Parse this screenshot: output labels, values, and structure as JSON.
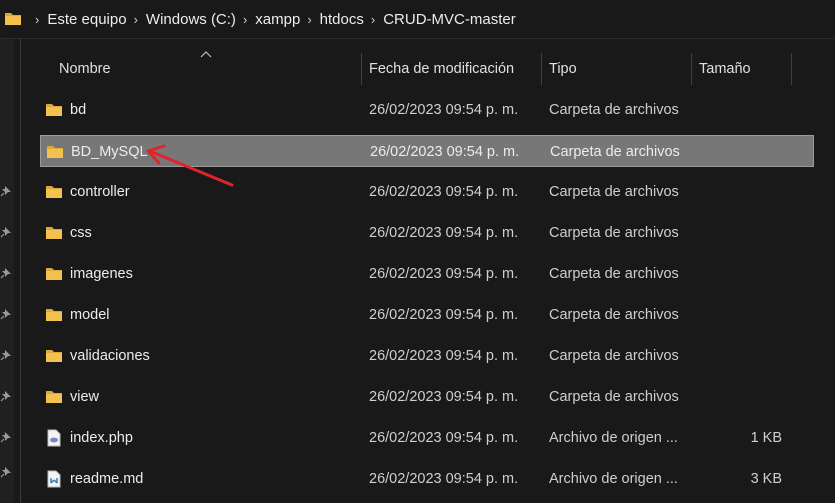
{
  "breadcrumb": {
    "items": [
      "Este equipo",
      "Windows (C:)",
      "xampp",
      "htdocs",
      "CRUD-MVC-master"
    ]
  },
  "columns": {
    "name": "Nombre",
    "date": "Fecha de modificación",
    "type": "Tipo",
    "size": "Tamaño"
  },
  "files": [
    {
      "name": "bd",
      "date": "26/02/2023 09:54 p. m.",
      "type": "Carpeta de archivos",
      "size": "",
      "icon": "folder-icon"
    },
    {
      "name": "BD_MySQL",
      "date": "26/02/2023 09:54 p. m.",
      "type": "Carpeta de archivos",
      "size": "",
      "icon": "folder-icon",
      "selected": true
    },
    {
      "name": "controller",
      "date": "26/02/2023 09:54 p. m.",
      "type": "Carpeta de archivos",
      "size": "",
      "icon": "folder-icon"
    },
    {
      "name": "css",
      "date": "26/02/2023 09:54 p. m.",
      "type": "Carpeta de archivos",
      "size": "",
      "icon": "folder-icon"
    },
    {
      "name": "imagenes",
      "date": "26/02/2023 09:54 p. m.",
      "type": "Carpeta de archivos",
      "size": "",
      "icon": "folder-icon"
    },
    {
      "name": "model",
      "date": "26/02/2023 09:54 p. m.",
      "type": "Carpeta de archivos",
      "size": "",
      "icon": "folder-icon"
    },
    {
      "name": "validaciones",
      "date": "26/02/2023 09:54 p. m.",
      "type": "Carpeta de archivos",
      "size": "",
      "icon": "folder-icon"
    },
    {
      "name": "view",
      "date": "26/02/2023 09:54 p. m.",
      "type": "Carpeta de archivos",
      "size": "",
      "icon": "folder-icon"
    },
    {
      "name": "index.php",
      "date": "26/02/2023 09:54 p. m.",
      "type": "Archivo de origen ...",
      "size": "1 KB",
      "icon": "php-file-icon"
    },
    {
      "name": "readme.md",
      "date": "26/02/2023 09:54 p. m.",
      "type": "Archivo de origen ...",
      "size": "3 KB",
      "icon": "markdown-file-icon"
    }
  ],
  "colors": {
    "background": "#191919",
    "selection": "#777777",
    "folder": "#f2c14e",
    "annotation_arrow": "#e0242c"
  }
}
